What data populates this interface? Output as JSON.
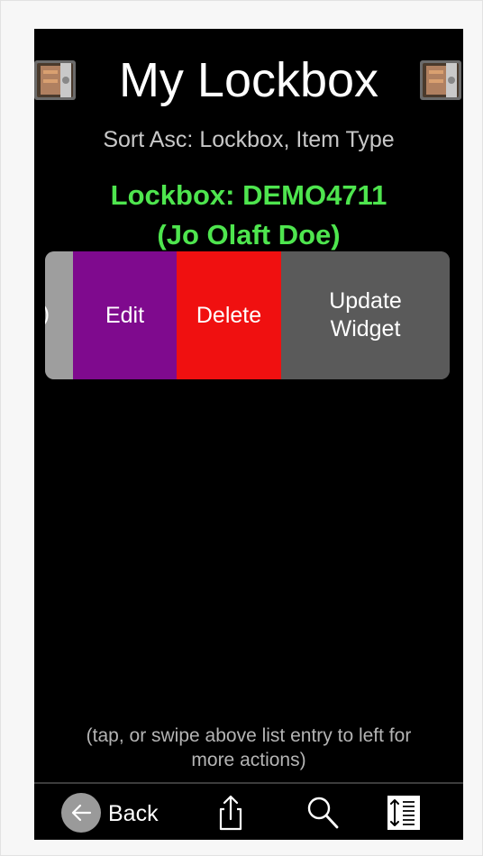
{
  "header": {
    "title": "My Lockbox",
    "sort_text": "Sort Asc: Lockbox, Item Type",
    "lockbox_line1": "Lockbox: DEMO4711",
    "lockbox_line2": "(Jo Olaft Doe)",
    "icon_left": "safe-icon",
    "icon_right": "safe-icon"
  },
  "row": {
    "stub_glyph": ")",
    "actions": [
      {
        "label": "Edit",
        "color": "#7f0a8e"
      },
      {
        "label": "Delete",
        "color": "#f01010"
      },
      {
        "label_line1": "Update",
        "label_line2": "Widget",
        "color": "#5a5a5a"
      }
    ]
  },
  "hint": {
    "line1": "(tap, or swipe above list entry to left for",
    "line2": "more actions)"
  },
  "toolbar": {
    "back_label": "Back",
    "back_icon": "arrow-left-icon",
    "share_icon": "share-icon",
    "search_icon": "search-icon",
    "sort_icon": "sort-icon"
  },
  "colors": {
    "accent_green": "#4ee54e",
    "background": "#000000"
  }
}
